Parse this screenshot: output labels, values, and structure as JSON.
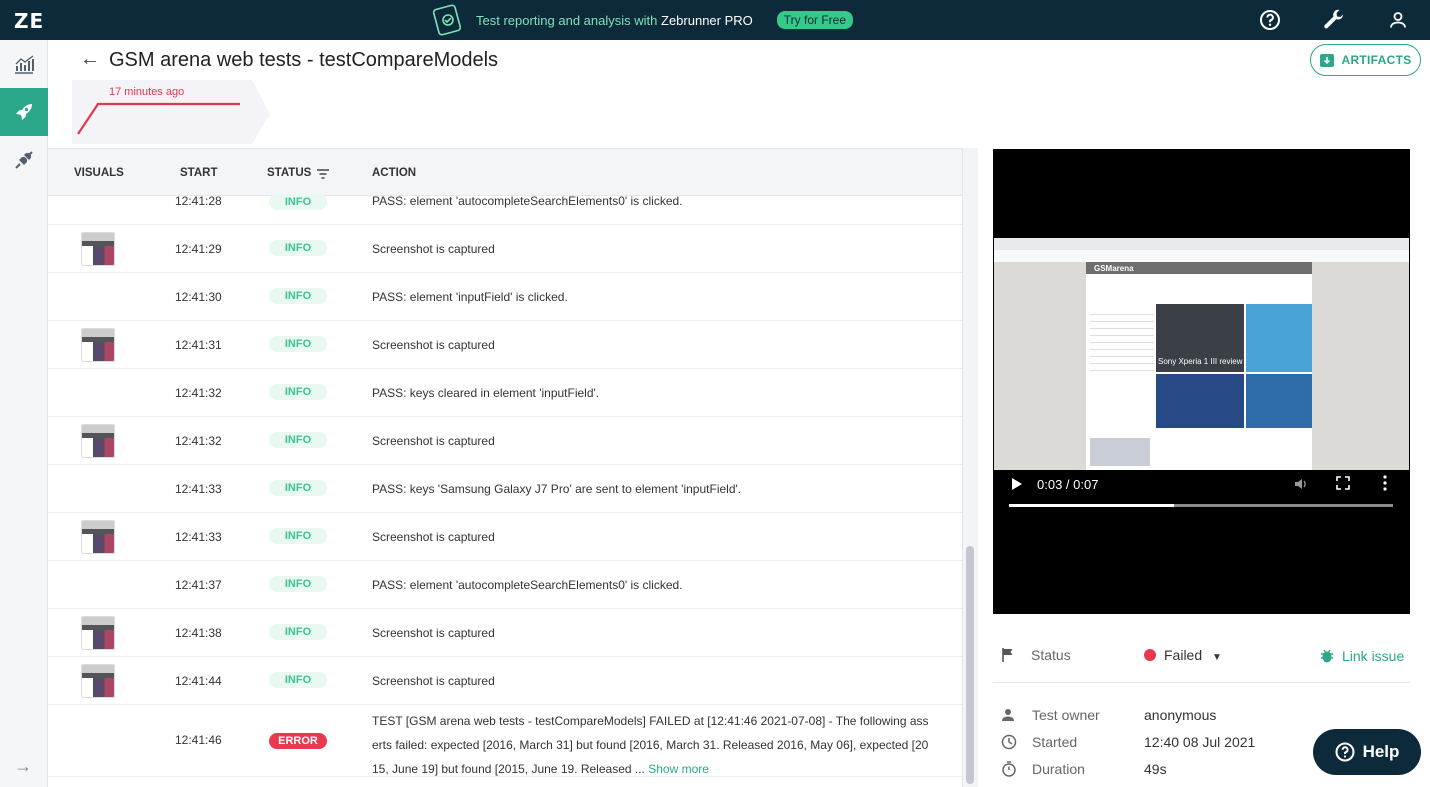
{
  "topbar": {
    "logo": "ZE",
    "promo_text": "Test reporting and analysis with",
    "promo_brand": "Zebrunner PRO",
    "promo_button": "Try for Free",
    "icons": [
      "help-circle-icon",
      "wrench-icon",
      "user-icon"
    ]
  },
  "sidenav": {
    "items": [
      "dashboard-chart-icon",
      "rocket-icon",
      "plug-icon"
    ],
    "active": "rocket-icon",
    "expand": "→"
  },
  "header": {
    "back": "←",
    "title": "GSM arena web tests - testCompareModels",
    "artifacts_label": "ARTIFACTS",
    "time_ago": "17 minutes ago"
  },
  "log": {
    "columns": [
      "VISUALS",
      "START",
      "STATUS",
      "ACTION"
    ],
    "rows": [
      {
        "thumb": false,
        "time": "12:41:28",
        "status": "INFO",
        "action": "PASS: element 'autocompleteSearchElements0' is clicked."
      },
      {
        "thumb": true,
        "time": "12:41:29",
        "status": "INFO",
        "action": "Screenshot is captured"
      },
      {
        "thumb": false,
        "time": "12:41:30",
        "status": "INFO",
        "action": "PASS: element 'inputField' is clicked."
      },
      {
        "thumb": true,
        "time": "12:41:31",
        "status": "INFO",
        "action": "Screenshot is captured"
      },
      {
        "thumb": false,
        "time": "12:41:32",
        "status": "INFO",
        "action": "PASS: keys cleared in element 'inputField'."
      },
      {
        "thumb": true,
        "time": "12:41:32",
        "status": "INFO",
        "action": "Screenshot is captured"
      },
      {
        "thumb": false,
        "time": "12:41:33",
        "status": "INFO",
        "action": "PASS: keys 'Samsung Galaxy J7 Pro' are sent to element 'inputField'."
      },
      {
        "thumb": true,
        "time": "12:41:33",
        "status": "INFO",
        "action": "Screenshot is captured"
      },
      {
        "thumb": false,
        "time": "12:41:37",
        "status": "INFO",
        "action": "PASS: element 'autocompleteSearchElements0' is clicked."
      },
      {
        "thumb": true,
        "time": "12:41:38",
        "status": "INFO",
        "action": "Screenshot is captured"
      },
      {
        "thumb": true,
        "time": "12:41:44",
        "status": "INFO",
        "action": "Screenshot is captured"
      }
    ],
    "error_row": {
      "time": "12:41:46",
      "status": "ERROR",
      "action_line1": "TEST [GSM arena web tests - testCompareModels] FAILED at [12:41:46 2021-07-08] - The following ass",
      "action_line2": "erts failed: expected [2016, March 31] but found [2016, March 31. Released 2016, May 06], expected [20",
      "action_line3": "15, June 19] but found [2015, June 19. Released ...",
      "show_more": "Show more"
    }
  },
  "video": {
    "time": "0:03 / 0:07",
    "progress_fraction": 0.43,
    "screenshot_site": "GSMarena",
    "screenshot_caption": "Sony Xperia 1 III review"
  },
  "details": {
    "status_label": "Status",
    "status_value": "Failed",
    "link_issue": "Link issue",
    "owner_label": "Test owner",
    "owner_value": "anonymous",
    "started_label": "Started",
    "started_value": "12:40 08 Jul 2021",
    "duration_label": "Duration",
    "duration_value": "49s"
  },
  "help_button": "Help",
  "colors": {
    "topbar": "#0d2a3a",
    "accent": "#2ba789",
    "error": "#e8394f",
    "info_text": "#3cc391"
  }
}
